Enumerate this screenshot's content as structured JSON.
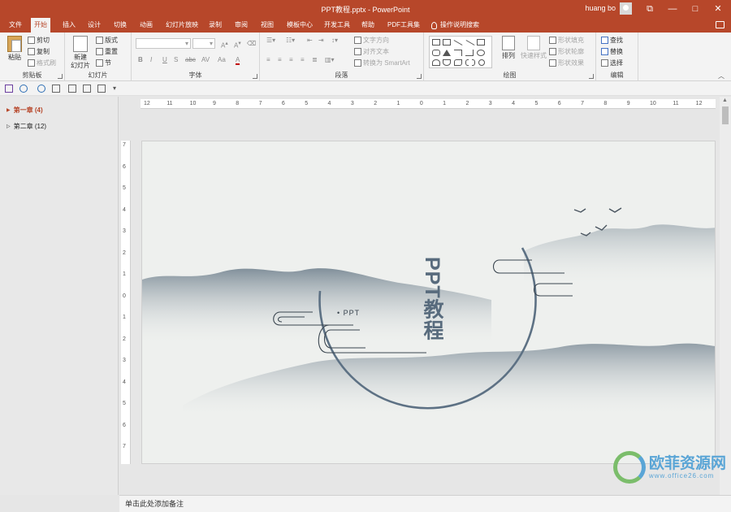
{
  "titlebar": {
    "title": "PPT教程.pptx  -  PowerPoint",
    "user": "huang bo",
    "buttons": [
      "⧉",
      "—",
      "□",
      "✕"
    ]
  },
  "tabs": [
    "文件",
    "开始",
    "插入",
    "设计",
    "切换",
    "动画",
    "幻灯片放映",
    "录制",
    "审阅",
    "视图",
    "模板中心",
    "开发工具",
    "帮助",
    "PDF工具集"
  ],
  "tell_me": "操作说明搜索",
  "ribbon": {
    "clipboard": {
      "label": "剪贴板",
      "paste": "粘贴",
      "cut": "剪切",
      "copy": "复制",
      "format_painter": "格式刷"
    },
    "slides": {
      "label": "幻灯片",
      "new_slide_1": "新建",
      "new_slide_2": "幻灯片",
      "layout": "版式",
      "reset": "重置",
      "section": "节"
    },
    "font": {
      "label": "字体",
      "bold": "B",
      "italic": "I",
      "underline": "U",
      "shadow": "S",
      "strike": "abc",
      "spacing": "AV",
      "case": "Aa",
      "color": "A"
    },
    "paragraph": {
      "label": "段落",
      "text_direction": "文字方向",
      "align_text": "对齐文本",
      "smartart": "转换为 SmartArt"
    },
    "drawing": {
      "label": "绘图",
      "arrange": "排列",
      "quick_styles": "快速样式",
      "shape_fill": "形状填充",
      "shape_outline": "形状轮廓",
      "shape_effects": "形状效果"
    },
    "editing": {
      "label": "编辑",
      "find": "查找",
      "replace": "替换",
      "select": "选择"
    }
  },
  "outline": {
    "items": [
      {
        "label": "第一章 (4)",
        "expanded": true
      },
      {
        "label": "第二章 (12)",
        "expanded": false
      }
    ]
  },
  "ruler": {
    "h_ticks": [
      "12",
      "11",
      "10",
      "9",
      "8",
      "7",
      "6",
      "5",
      "4",
      "3",
      "2",
      "1",
      "0",
      "1",
      "2",
      "3",
      "4",
      "5",
      "6",
      "7",
      "8",
      "9",
      "10",
      "11",
      "12"
    ],
    "v_ticks": [
      "7",
      "6",
      "5",
      "4",
      "3",
      "2",
      "1",
      "0",
      "1",
      "2",
      "3",
      "4",
      "5",
      "6",
      "7"
    ]
  },
  "slide": {
    "title": "PPT教程",
    "subtitle": "• PPT"
  },
  "notes": {
    "placeholder": "单击此处添加备注"
  },
  "watermark": {
    "text": "欧菲资源网",
    "url": "www.office26.com"
  },
  "colors": {
    "accent": "#b7472a",
    "ink": "#5d7184",
    "slide_bg": "#eef0ee"
  }
}
